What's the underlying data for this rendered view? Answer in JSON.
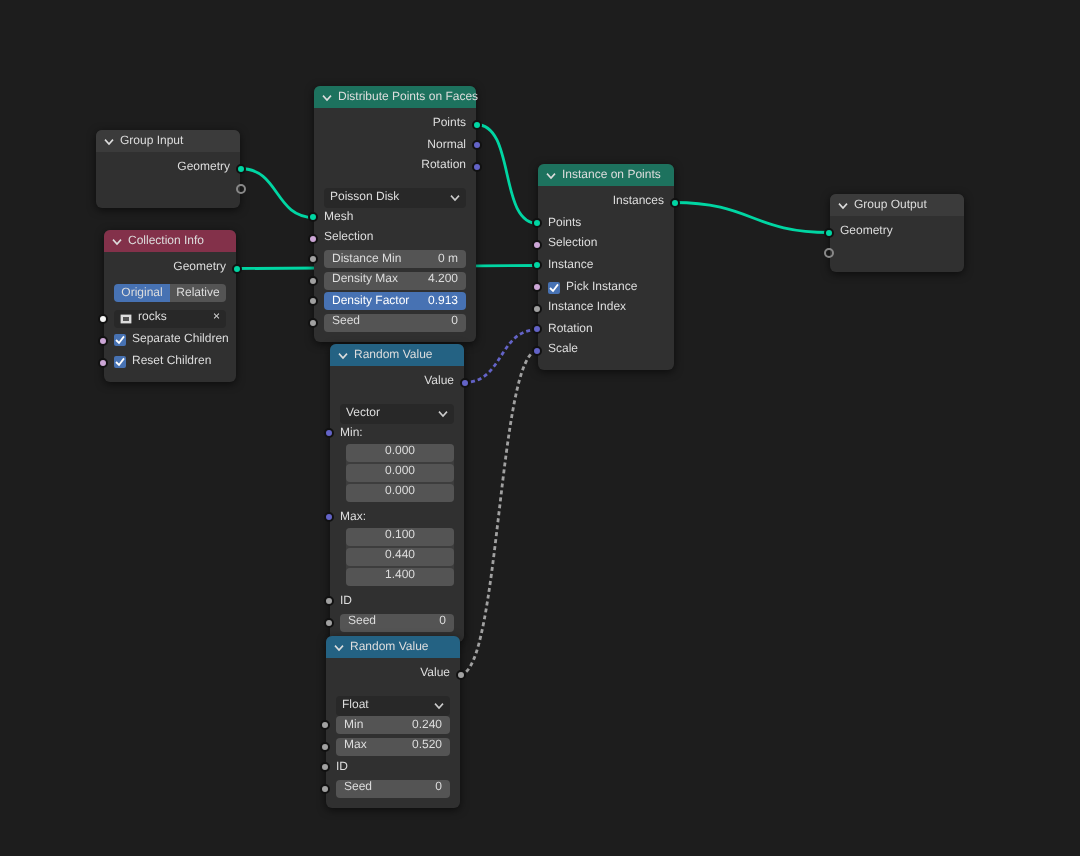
{
  "nodes": [
    {
      "title": "Group Input",
      "kind": "group",
      "rows": [
        {
          "kind": "output",
          "label": "Geometry",
          "color": "#00d6a3"
        },
        {
          "kind": "empty"
        }
      ]
    },
    {
      "title": "Collection Info",
      "kind": "input",
      "rows": [
        {
          "kind": "output",
          "label": "Geometry",
          "color": "#00d6a3"
        },
        {
          "kind": "toggle",
          "options": [
            {
              "label": "Original",
              "selected": true
            },
            {
              "label": "Relative",
              "selected": false
            }
          ]
        },
        {
          "kind": "collection",
          "value": "rocks",
          "clear": "×",
          "color": "#f5f5f5"
        },
        {
          "kind": "checkbox",
          "label": "Separate Children",
          "checked": true,
          "color": "#cca6d6"
        },
        {
          "kind": "checkbox",
          "label": "Reset Children",
          "checked": true,
          "color": "#cca6d6"
        }
      ]
    },
    {
      "title": "Distribute Points on Faces",
      "kind": "geometry",
      "rows": [
        {
          "kind": "output",
          "label": "Points",
          "color": "#00d6a3"
        },
        {
          "kind": "output",
          "label": "Normal",
          "color": "#6363c7"
        },
        {
          "kind": "output",
          "label": "Rotation",
          "color": "#6363c7"
        },
        {
          "kind": "dropdown",
          "value": "Poisson Disk"
        },
        {
          "kind": "input",
          "label": "Mesh",
          "color": "#00d6a3"
        },
        {
          "kind": "input",
          "label": "Selection",
          "color": "#cca6d6"
        },
        {
          "kind": "field",
          "label": "Distance Min",
          "value": "0 m",
          "selected": false,
          "color": "#a1a1a1"
        },
        {
          "kind": "field",
          "label": "Density Max",
          "value": "4.200",
          "selected": false,
          "color": "#a1a1a1"
        },
        {
          "kind": "field",
          "label": "Density Factor",
          "value": "0.913",
          "selected": true,
          "color": "#a1a1a1"
        },
        {
          "kind": "field",
          "label": "Seed",
          "value": "0",
          "selected": false,
          "color": "#a1a1a1"
        }
      ]
    },
    {
      "title": "Instance on Points",
      "kind": "geometry",
      "rows": [
        {
          "kind": "output",
          "label": "Instances",
          "color": "#00d6a3"
        },
        {
          "kind": "input",
          "label": "Points",
          "color": "#00d6a3"
        },
        {
          "kind": "input",
          "label": "Selection",
          "color": "#cca6d6"
        },
        {
          "kind": "input",
          "label": "Instance",
          "color": "#00d6a3"
        },
        {
          "kind": "checkbox",
          "label": "Pick Instance",
          "checked": true,
          "color": "#cca6d6"
        },
        {
          "kind": "input",
          "label": "Instance Index",
          "color": "#a1a1a1"
        },
        {
          "kind": "input",
          "label": "Rotation",
          "color": "#6363c7"
        },
        {
          "kind": "input",
          "label": "Scale",
          "color": "#6363c7"
        }
      ]
    },
    {
      "title": "Group Output",
      "kind": "group",
      "rows": [
        {
          "kind": "input",
          "label": "Geometry",
          "color": "#00d6a3"
        },
        {
          "kind": "empty"
        }
      ]
    },
    {
      "title": "Random Value",
      "kind": "utility",
      "rows": [
        {
          "kind": "output",
          "label": "Value",
          "color": "#6363c7"
        },
        {
          "kind": "dropdown",
          "value": "Vector"
        },
        {
          "kind": "vector",
          "label": "Min:",
          "values": [
            "0.000",
            "0.000",
            "0.000"
          ],
          "color": "#6363c7"
        },
        {
          "kind": "vector",
          "label": "Max:",
          "values": [
            "0.100",
            "0.440",
            "1.400"
          ],
          "color": "#6363c7"
        },
        {
          "kind": "input",
          "label": "ID",
          "color": "#a1a1a1"
        },
        {
          "kind": "field",
          "label": "Seed",
          "value": "0",
          "selected": false,
          "color": "#a1a1a1"
        }
      ]
    },
    {
      "title": "Random Value",
      "kind": "utility",
      "rows": [
        {
          "kind": "output",
          "label": "Value",
          "color": "#a1a1a1"
        },
        {
          "kind": "dropdown",
          "value": "Float"
        },
        {
          "kind": "field",
          "label": "Min",
          "value": "0.240",
          "selected": false,
          "color": "#a1a1a1"
        },
        {
          "kind": "field",
          "label": "Max",
          "value": "0.520",
          "selected": false,
          "color": "#a1a1a1"
        },
        {
          "kind": "input",
          "label": "ID",
          "color": "#a1a1a1"
        },
        {
          "kind": "field",
          "label": "Seed",
          "value": "0",
          "selected": false,
          "color": "#a1a1a1"
        }
      ]
    }
  ]
}
